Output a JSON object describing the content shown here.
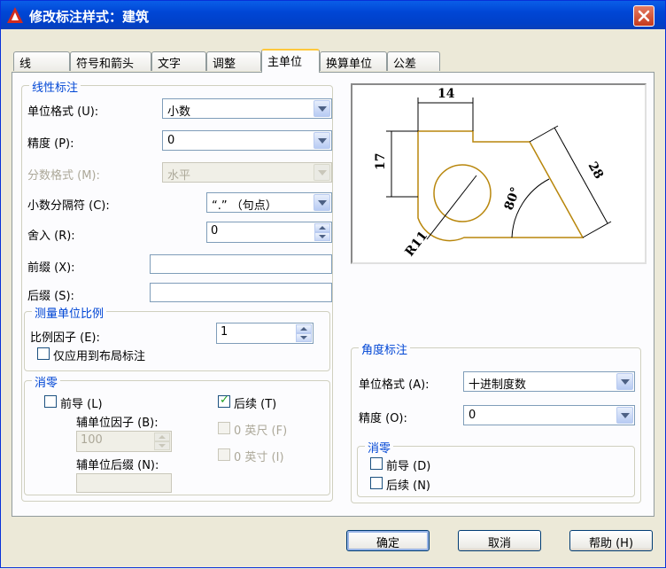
{
  "window": {
    "title": "修改标注样式：建筑"
  },
  "tabs": [
    {
      "label": "线"
    },
    {
      "label": "符号和箭头"
    },
    {
      "label": "文字"
    },
    {
      "label": "调整"
    },
    {
      "label": "主单位"
    },
    {
      "label": "换算单位"
    },
    {
      "label": "公差"
    }
  ],
  "linear": {
    "group_title": "线性标注",
    "unit_format_label": "单位格式 (U):",
    "unit_format_value": "小数",
    "precision_label": "精度 (P):",
    "precision_value": "0",
    "fraction_format_label": "分数格式 (M):",
    "fraction_format_value": "水平",
    "decimal_sep_label": "小数分隔符 (C):",
    "decimal_sep_value": "“.” （句点）",
    "round_label": "舍入 (R):",
    "round_value": "0",
    "prefix_label": "前缀 (X):",
    "prefix_value": "",
    "suffix_label": "后缀 (S):",
    "suffix_value": ""
  },
  "scale": {
    "group_title": "测量单位比例",
    "factor_label": "比例因子 (E):",
    "factor_value": "1",
    "layout_only_label": "仅应用到布局标注"
  },
  "zero_linear": {
    "group_title": "消零",
    "leading_label": "前导 (L)",
    "sub_factor_label": "辅单位因子 (B):",
    "sub_factor_value": "100",
    "sub_suffix_label": "辅单位后缀 (N):",
    "trailing_label": "后续 (T)",
    "feet_label": "0 英尺 (F)",
    "inches_label": "0 英寸 (I)"
  },
  "preview": {
    "dim_top": "14",
    "dim_left": "17",
    "dim_right": "28",
    "dim_angle": "80°",
    "dim_radius": "R11"
  },
  "angular": {
    "group_title": "角度标注",
    "unit_format_label": "单位格式 (A):",
    "unit_format_value": "十进制度数",
    "precision_label": "精度 (O):",
    "precision_value": "0"
  },
  "zero_angular": {
    "group_title": "消零",
    "leading_label": "前导 (D)",
    "trailing_label": "后续 (N)"
  },
  "buttons": {
    "ok": "确定",
    "cancel": "取消",
    "help": "帮助 (H)"
  },
  "colors": {
    "title_bar": "#0046d5",
    "accent_text": "#0046d5",
    "shape_stroke": "#b8860b"
  }
}
